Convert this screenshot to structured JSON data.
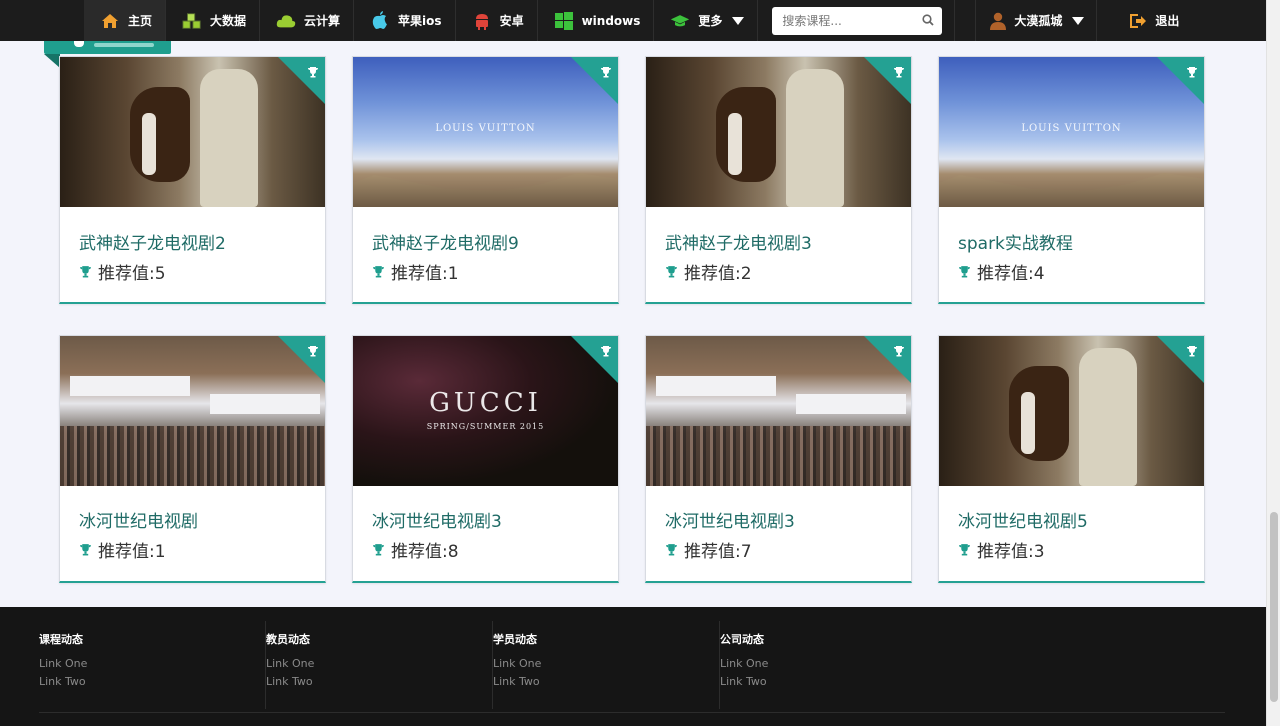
{
  "nav": {
    "items": [
      {
        "label": "主页",
        "icon": "home-icon",
        "color": "#f0a030"
      },
      {
        "label": "大数据",
        "icon": "cubes-icon",
        "color": "#9acd32"
      },
      {
        "label": "云计算",
        "icon": "cloud-icon",
        "color": "#9acd32"
      },
      {
        "label": "苹果ios",
        "icon": "apple-icon",
        "color": "#48c9e8"
      },
      {
        "label": "安卓",
        "icon": "android-icon",
        "color": "#e0443a"
      },
      {
        "label": "windows",
        "icon": "windows-icon",
        "color": "#3cc23c"
      },
      {
        "label": "更多",
        "icon": "graduation-cap-icon",
        "color": "#3cc23c"
      }
    ],
    "search_placeholder": "搜索课程...",
    "user_label": "大漠孤城",
    "logout_label": "退出"
  },
  "courses": [
    {
      "title": "武神赵子龙电视剧2",
      "score_label": "推荐值:5",
      "thumb": "horse"
    },
    {
      "title": "武神赵子龙电视剧9",
      "score_label": "推荐值:1",
      "thumb": "sky",
      "thumb_text": "LOUIS VUITTON"
    },
    {
      "title": "武神赵子龙电视剧3",
      "score_label": "推荐值:2",
      "thumb": "horse"
    },
    {
      "title": "spark实战教程",
      "score_label": "推荐值:4",
      "thumb": "sky",
      "thumb_text": "LOUIS VUITTON"
    },
    {
      "title": "冰河世纪电视剧",
      "score_label": "推荐值:1",
      "thumb": "market"
    },
    {
      "title": "冰河世纪电视剧3",
      "score_label": "推荐值:8",
      "thumb": "gucci",
      "thumb_text": "GUCCI",
      "thumb_subtext": "SPRING/SUMMER 2015"
    },
    {
      "title": "冰河世纪电视剧3",
      "score_label": "推荐值:7",
      "thumb": "market"
    },
    {
      "title": "冰河世纪电视剧5",
      "score_label": "推荐值:3",
      "thumb": "horse"
    }
  ],
  "footer": {
    "columns": [
      {
        "heading": "课程动态",
        "links": [
          "Link One",
          "Link Two"
        ]
      },
      {
        "heading": "教员动态",
        "links": [
          "Link One",
          "Link Two"
        ]
      },
      {
        "heading": "学员动态",
        "links": [
          "Link One",
          "Link Two"
        ]
      },
      {
        "heading": "公司动态",
        "links": [
          "Link One",
          "Link Two"
        ]
      }
    ]
  },
  "colors": {
    "accent": "#24a193",
    "title": "#1f6b66",
    "navbar": "#1c1c1c",
    "footer": "#151515"
  }
}
